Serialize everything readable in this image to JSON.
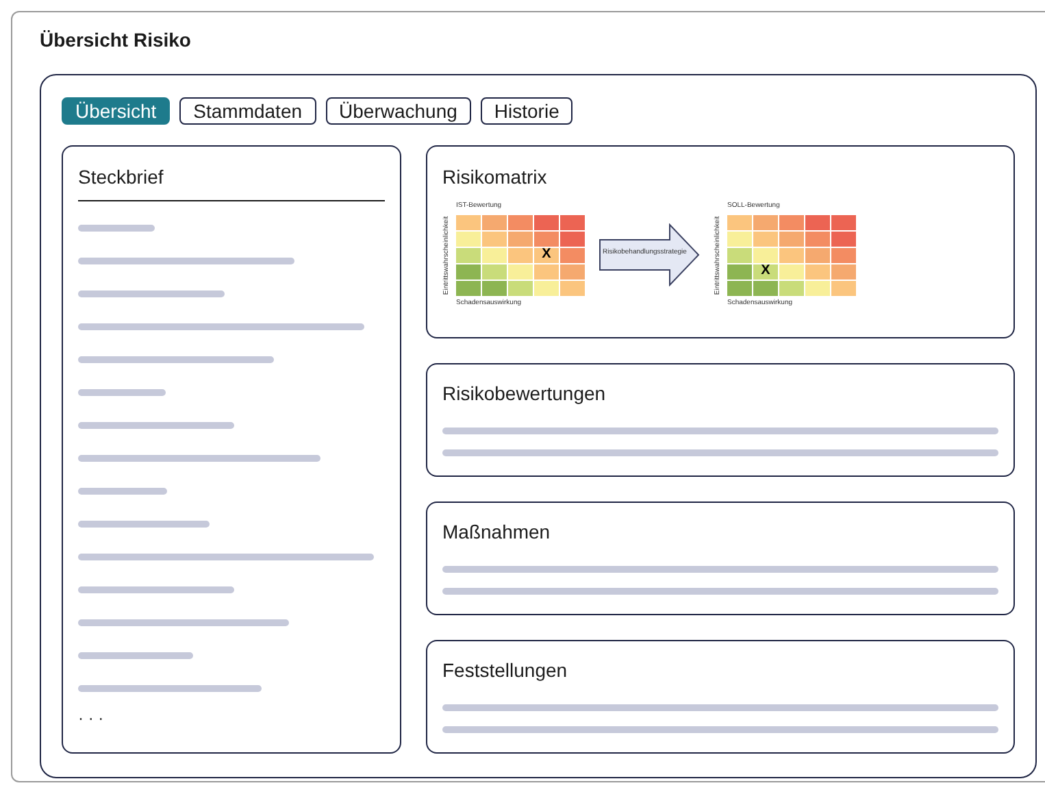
{
  "title": "Übersicht Risiko",
  "tabs": [
    {
      "label": "Übersicht",
      "selected": true
    },
    {
      "label": "Stammdaten",
      "selected": false
    },
    {
      "label": "Überwachung",
      "selected": false
    },
    {
      "label": "Historie",
      "selected": false
    }
  ],
  "profile": {
    "title": "Steckbrief",
    "more": "· · ·"
  },
  "risk_matrix": {
    "title": "Risikomatrix",
    "strategy": "Risikobehandlungsstrategie",
    "matrices": [
      {
        "title": "IST-Bewertung",
        "y_label": "Eintrittswahrscheinlichkeit",
        "x_label": "Schadensauswirkung",
        "rows": [
          [
            {
              "color": "#fbc57e"
            },
            {
              "color": "#f5a96f"
            },
            {
              "color": "#f38c62"
            },
            {
              "color": "#ec6453"
            },
            {
              "color": "#ec6453"
            }
          ],
          [
            {
              "color": "#f8ef99"
            },
            {
              "color": "#fbc57e"
            },
            {
              "color": "#f5a96f"
            },
            {
              "color": "#f38c62"
            },
            {
              "color": "#ec6453"
            }
          ],
          [
            {
              "color": "#c9dc7a"
            },
            {
              "color": "#f8ef99"
            },
            {
              "color": "#fbc57e"
            },
            {
              "color": "#fbc57e",
              "text": "X"
            },
            {
              "color": "#f38c62"
            }
          ],
          [
            {
              "color": "#8db552"
            },
            {
              "color": "#c9dc7a"
            },
            {
              "color": "#f8ef99"
            },
            {
              "color": "#fbc57e"
            },
            {
              "color": "#f5a96f"
            }
          ],
          [
            {
              "color": "#8db552"
            },
            {
              "color": "#8db552"
            },
            {
              "color": "#c9dc7a"
            },
            {
              "color": "#f8ef99"
            },
            {
              "color": "#fbc57e"
            }
          ]
        ]
      },
      {
        "title": "SOLL-Bewertung",
        "y_label": "Eintrittswahrscheinlichkeit",
        "x_label": "Schadensauswirkung",
        "rows": [
          [
            {
              "color": "#fbc57e"
            },
            {
              "color": "#f5a96f"
            },
            {
              "color": "#f38c62"
            },
            {
              "color": "#ec6453"
            },
            {
              "color": "#ec6453"
            }
          ],
          [
            {
              "color": "#f8ef99"
            },
            {
              "color": "#fbc57e"
            },
            {
              "color": "#f5a96f"
            },
            {
              "color": "#f38c62"
            },
            {
              "color": "#ec6453"
            }
          ],
          [
            {
              "color": "#c9dc7a"
            },
            {
              "color": "#f8ef99"
            },
            {
              "color": "#fbc57e"
            },
            {
              "color": "#f5a96f"
            },
            {
              "color": "#f38c62"
            }
          ],
          [
            {
              "color": "#8db552"
            },
            {
              "color": "#c9dc7a",
              "text": "X"
            },
            {
              "color": "#f8ef99"
            },
            {
              "color": "#fbc57e"
            },
            {
              "color": "#f5a96f"
            }
          ],
          [
            {
              "color": "#8db552"
            },
            {
              "color": "#8db552"
            },
            {
              "color": "#c9dc7a"
            },
            {
              "color": "#f8ef99"
            },
            {
              "color": "#fbc57e"
            }
          ]
        ]
      }
    ]
  },
  "sections": [
    {
      "title": "Risikobewertungen"
    },
    {
      "title": "Maßnahmen"
    },
    {
      "title": "Feststellungen"
    }
  ]
}
